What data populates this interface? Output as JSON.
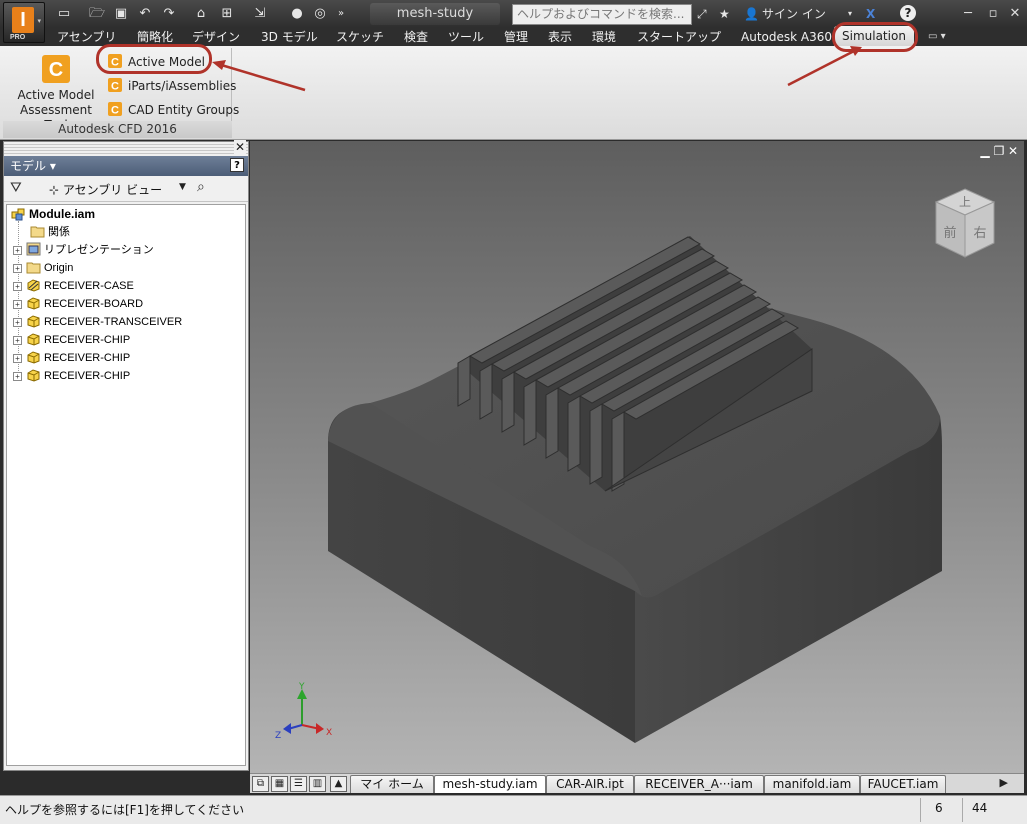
{
  "app": {
    "logo_letter": "I",
    "edition": "PRO",
    "document_title": "mesh-study",
    "search_placeholder": "ヘルプおよびコマンドを検索...",
    "sign_in_label": "サイン イン",
    "help_label": "?"
  },
  "ribbon_tabs": [
    {
      "label": "アセンブリ"
    },
    {
      "label": "簡略化"
    },
    {
      "label": "デザイン"
    },
    {
      "label": "3D モデル"
    },
    {
      "label": "スケッチ"
    },
    {
      "label": "検査"
    },
    {
      "label": "ツール"
    },
    {
      "label": "管理"
    },
    {
      "label": "表示"
    },
    {
      "label": "環境"
    },
    {
      "label": "スタートアップ"
    },
    {
      "label": "Autodesk A360"
    },
    {
      "label": "Simulation",
      "active": true
    }
  ],
  "ribbon": {
    "panel_title": "Autodesk CFD 2016",
    "big_tool_line1": "Active Model",
    "big_tool_line2": "Assessment Tool",
    "tools": [
      {
        "label": "Active Model",
        "icon": "cfd-icon"
      },
      {
        "label": "iParts/iAssemblies",
        "icon": "cfd-icon"
      },
      {
        "label": "CAD Entity Groups",
        "icon": "cfd-icon"
      }
    ]
  },
  "browser": {
    "header": "モデル ▾",
    "view_selector": "アセンブリ ビュー",
    "tree": [
      {
        "label": "Module.iam",
        "icon": "assembly-icon",
        "root": true
      },
      {
        "label": "関係",
        "icon": "folder-icon",
        "expander": false
      },
      {
        "label": "リプレゼンテーション",
        "icon": "representation-icon",
        "expander": true
      },
      {
        "label": "Origin",
        "icon": "folder-icon",
        "expander": true
      },
      {
        "label": "RECEIVER-CASE",
        "icon": "part-hatched-icon",
        "expander": true
      },
      {
        "label": "RECEIVER-BOARD",
        "icon": "part-icon",
        "expander": true
      },
      {
        "label": "RECEIVER-TRANSCEIVER",
        "icon": "part-icon",
        "expander": true
      },
      {
        "label": "RECEIVER-CHIP",
        "icon": "part-icon",
        "expander": true
      },
      {
        "label": "RECEIVER-CHIP",
        "icon": "part-icon",
        "expander": true
      },
      {
        "label": "RECEIVER-CHIP",
        "icon": "part-icon",
        "expander": true
      }
    ]
  },
  "viewcube": {
    "top_face": "上",
    "front_face": "前",
    "right_face": "右"
  },
  "triad": {
    "x": "X",
    "y": "Y",
    "z": "Z"
  },
  "doc_tabs": [
    {
      "label": "マイ ホーム"
    },
    {
      "label": "mesh-study.iam",
      "active": true
    },
    {
      "label": "CAR-AIR.ipt"
    },
    {
      "label": "RECEIVER_A···iam"
    },
    {
      "label": "manifold.iam"
    },
    {
      "label": "FAUCET.iam"
    }
  ],
  "status": {
    "message": "ヘルプを参照するには[F1]を押してください",
    "count1": "6",
    "count2": "44"
  },
  "colors": {
    "annotation": "#b0332a",
    "cfd_orange": "#f0a020",
    "model_gray": "#4a4a4a"
  }
}
